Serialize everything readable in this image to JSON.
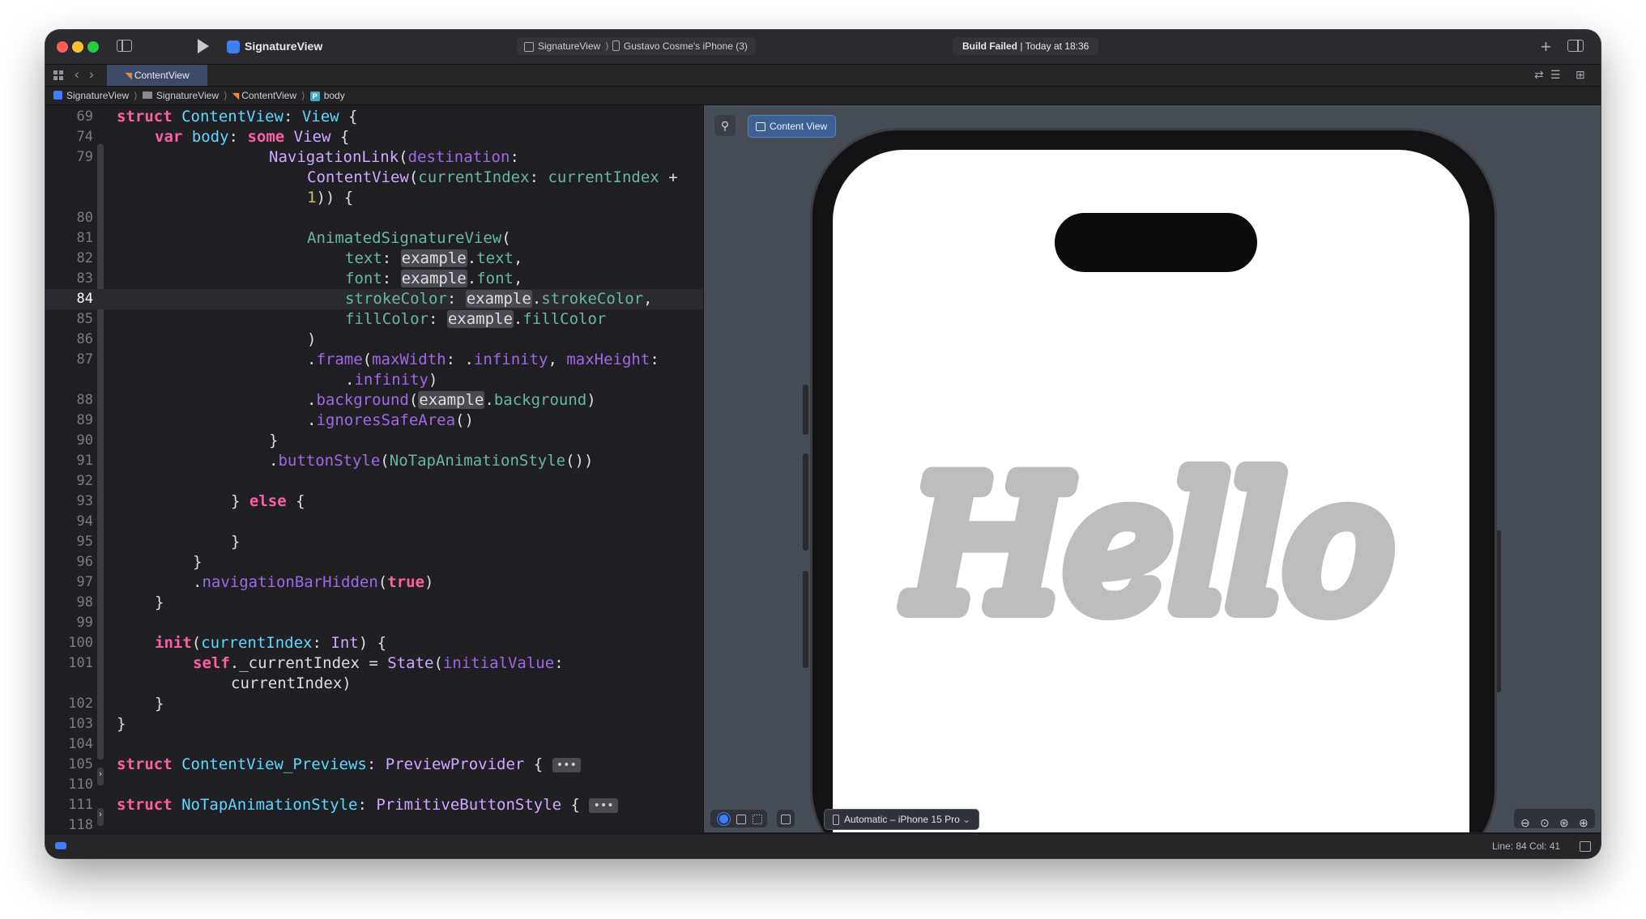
{
  "titlebar": {
    "app_name": "SignatureView",
    "scheme_project": "SignatureView",
    "scheme_device": "Gustavo Cosme's iPhone (3)",
    "build_status_bold": "Build Failed",
    "build_status_rest": " | Today at 18:36"
  },
  "tabbar": {
    "active_tab": "ContentView"
  },
  "jumpbar": {
    "items": [
      "SignatureView",
      "SignatureView",
      "ContentView",
      "body"
    ]
  },
  "editor": {
    "current_line": 84,
    "lines": [
      {
        "n": "69",
        "row": 0
      },
      {
        "n": "74",
        "row": 1
      },
      {
        "n": "79",
        "row": 2
      },
      {
        "n": "",
        "row": 3
      },
      {
        "n": "",
        "row": 4
      },
      {
        "n": "80",
        "row": 5
      },
      {
        "n": "81",
        "row": 6
      },
      {
        "n": "82",
        "row": 7
      },
      {
        "n": "83",
        "row": 8
      },
      {
        "n": "84",
        "row": 9
      },
      {
        "n": "85",
        "row": 10
      },
      {
        "n": "86",
        "row": 11
      },
      {
        "n": "87",
        "row": 12
      },
      {
        "n": "",
        "row": 13
      },
      {
        "n": "88",
        "row": 14
      },
      {
        "n": "89",
        "row": 15
      },
      {
        "n": "90",
        "row": 16
      },
      {
        "n": "91",
        "row": 17
      },
      {
        "n": "92",
        "row": 18
      },
      {
        "n": "93",
        "row": 19
      },
      {
        "n": "94",
        "row": 20
      },
      {
        "n": "95",
        "row": 21
      },
      {
        "n": "96",
        "row": 22
      },
      {
        "n": "97",
        "row": 23
      },
      {
        "n": "98",
        "row": 24
      },
      {
        "n": "99",
        "row": 25
      },
      {
        "n": "100",
        "row": 26
      },
      {
        "n": "101",
        "row": 27
      },
      {
        "n": "",
        "row": 28
      },
      {
        "n": "102",
        "row": 29
      },
      {
        "n": "103",
        "row": 30
      },
      {
        "n": "104",
        "row": 31
      },
      {
        "n": "105",
        "row": 32
      },
      {
        "n": "110",
        "row": 33
      },
      {
        "n": "111",
        "row": 34
      },
      {
        "n": "118",
        "row": 35
      }
    ]
  },
  "code": {
    "struct_kw": "struct",
    "content_view": "ContentView",
    "view": "View",
    "var_kw": "var",
    "body": "body",
    "some_kw": "some",
    "nav_link": "NavigationLink",
    "destination": "destination",
    "current_index_label": "currentIndex",
    "current_index_val": "currentIndex",
    "one": "1",
    "animated_sig": "AnimatedSignatureView",
    "text_label": "text",
    "font_label": "font",
    "stroke_label": "strokeColor",
    "fill_label": "fillColor",
    "example": "example",
    "text_prop": "text",
    "font_prop": "font",
    "stroke_prop": "strokeColor",
    "fill_prop": "fillColor",
    "frame": "frame",
    "max_width": "maxWidth",
    "infinity": "infinity",
    "max_height": "maxHeight",
    "background": "background",
    "ignores_safe": "ignoresSafeArea",
    "button_style": "buttonStyle",
    "no_tap_style": "NoTapAnimationStyle",
    "else_kw": "else",
    "nav_bar_hidden": "navigationBarHidden",
    "true_kw": "true",
    "init_kw": "init",
    "int_type": "Int",
    "self_kw": "self",
    "under_current": "_currentIndex",
    "state": "State",
    "initial_value": "initialValue",
    "previews_struct": "ContentView_Previews",
    "preview_provider": "PreviewProvider",
    "primitive_style": "PrimitiveButtonStyle",
    "fold_dots": "•••"
  },
  "preview": {
    "canvas_button": "Content View",
    "device_selector": "Automatic – iPhone 15 Pro",
    "hello_text": "Hello",
    "hello_color": "#bdbdbd"
  },
  "statusbar": {
    "position": "Line: 84  Col: 41"
  },
  "colors": {
    "accent": "#3f7ef7",
    "keyword": "#fc5fa3",
    "type": "#5dd8ff",
    "function": "#a167e6"
  }
}
